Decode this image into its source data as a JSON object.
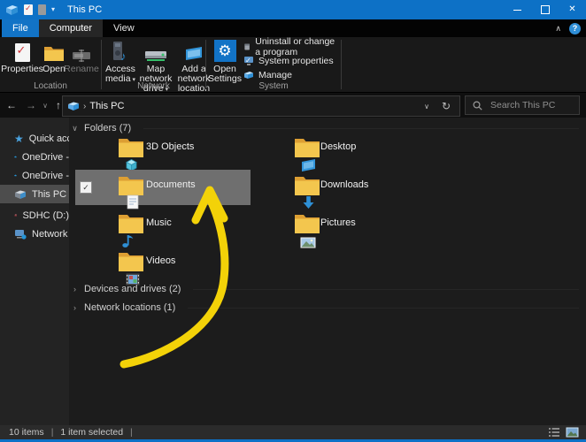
{
  "window": {
    "title": "This PC"
  },
  "icons": {
    "back": "←",
    "forward": "→",
    "up": "↑",
    "chevron_down": "∨",
    "chevron_right": "›",
    "refresh": "↻",
    "collapse": "∧",
    "help": "?",
    "close": "✕",
    "gear": "⚙",
    "check": "✓",
    "note": "♪",
    "star": "★",
    "dropdown": "▾",
    "breadcrumb_sep": "›"
  },
  "tabs": {
    "file": "File",
    "computer": "Computer",
    "view": "View"
  },
  "ribbon": {
    "groups": [
      {
        "label": "Location",
        "buttons": [
          {
            "label": "Properties"
          },
          {
            "label": "Open"
          },
          {
            "label": "Rename"
          }
        ]
      },
      {
        "label": "Network",
        "buttons": [
          {
            "line1": "Access",
            "line2": "media"
          },
          {
            "line1": "Map network",
            "line2": "drive"
          },
          {
            "line1": "Add a network",
            "line2": "location"
          }
        ]
      },
      {
        "label": "System",
        "big": {
          "line1": "Open",
          "line2": "Settings"
        },
        "small": [
          {
            "label": "Uninstall or change a program"
          },
          {
            "label": "System properties"
          },
          {
            "label": "Manage"
          }
        ]
      }
    ]
  },
  "addressbar": {
    "path": "This PC",
    "search_placeholder": "Search This PC"
  },
  "sidebar": {
    "items": [
      {
        "label": "Quick access"
      },
      {
        "label": "OneDrive -"
      },
      {
        "label": "OneDrive -"
      },
      {
        "label": "This PC"
      },
      {
        "label": "SDHC (D:)"
      },
      {
        "label": "Network"
      }
    ]
  },
  "main": {
    "groups": [
      {
        "label": "Folders (7)"
      },
      {
        "label": "Devices and drives (2)"
      },
      {
        "label": "Network locations (1)"
      }
    ],
    "folders": [
      {
        "label": "3D Objects"
      },
      {
        "label": "Documents"
      },
      {
        "label": "Music"
      },
      {
        "label": "Videos"
      },
      {
        "label": "Desktop"
      },
      {
        "label": "Downloads"
      },
      {
        "label": "Pictures"
      }
    ]
  },
  "statusbar": {
    "items_count": "10 items",
    "selected": "1 item selected",
    "sep": "|"
  },
  "colors": {
    "accent": "#0d71c6",
    "selection": "#6f6f6f",
    "arrow": "#f3d208",
    "folder": "#f3c64e"
  }
}
